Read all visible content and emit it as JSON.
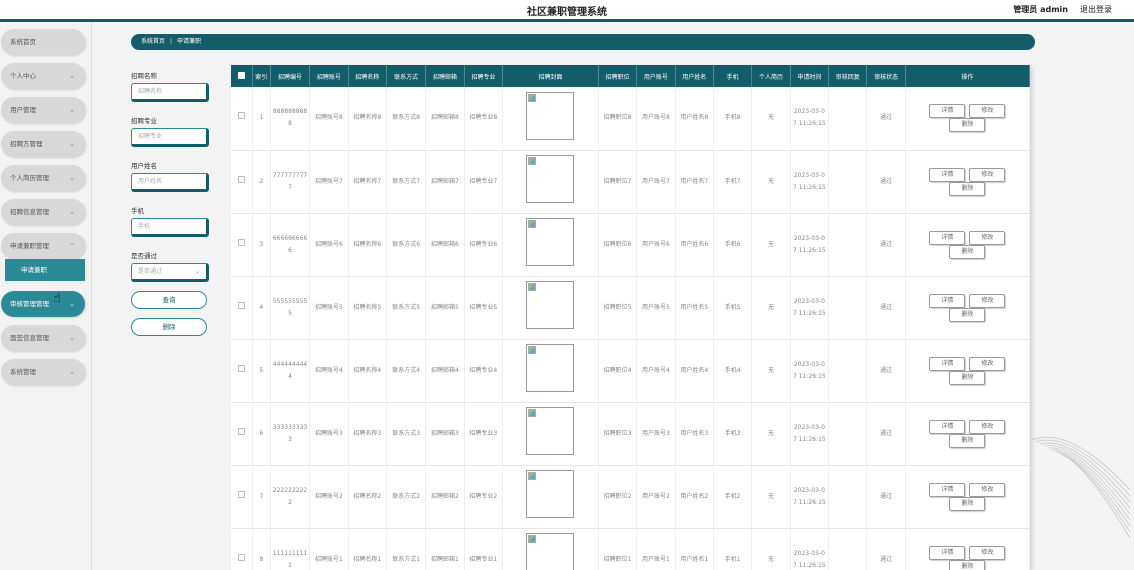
{
  "header": {
    "title": "社区兼职管理系统",
    "user": "管理员 admin",
    "logout": "退出登录"
  },
  "sidebar": {
    "items": [
      {
        "label": "系统首页",
        "chevron": false,
        "active": false
      },
      {
        "label": "个人中心",
        "chevron": true,
        "active": false
      },
      {
        "label": "用户管理",
        "chevron": true,
        "active": false
      },
      {
        "label": "招聘方管理",
        "chevron": true,
        "active": false
      },
      {
        "label": "个人简历管理",
        "chevron": true,
        "active": false
      },
      {
        "label": "招聘信息管理",
        "chevron": true,
        "active": false
      },
      {
        "label": "申请兼职管理",
        "chevron": true,
        "active": false
      },
      {
        "label": "审核管理管理",
        "chevron": true,
        "active": true
      },
      {
        "label": "面签信息管理",
        "chevron": true,
        "active": false
      },
      {
        "label": "系统管理",
        "chevron": true,
        "active": false
      }
    ],
    "sub_item": "申请兼职"
  },
  "breadcrumb": {
    "home": "系统首页",
    "current": "申请兼职"
  },
  "search": {
    "name_label": "招聘名称",
    "name_placeholder": "招聘名称",
    "major_label": "招聘专业",
    "major_placeholder": "招聘专业",
    "username_label": "用户姓名",
    "username_placeholder": "用户姓名",
    "phone_label": "手机",
    "phone_placeholder": "手机",
    "pass_label": "是否通过",
    "pass_placeholder": "是否通过",
    "query_button": "查询",
    "delete_button": "删除"
  },
  "table": {
    "headers": [
      "索引",
      "招聘编号",
      "招聘账号",
      "招聘名称",
      "联系方式",
      "招聘邮箱",
      "招聘专业",
      "招聘封面",
      "招聘职位",
      "用户账号",
      "用户姓名",
      "手机",
      "个人简历",
      "申请时间",
      "审核回复",
      "审核状态",
      "操作"
    ],
    "actions": {
      "detail": "详情",
      "edit": "修改",
      "delete": "删除"
    },
    "rows": [
      {
        "index": "1",
        "code": "8888888888",
        "account": "招聘账号8",
        "name": "招聘名称8",
        "contact": "联系方式8",
        "email": "招聘邮箱8",
        "major": "招聘专业8",
        "position": "招聘职位8",
        "user_account": "用户账号8",
        "user_name": "用户姓名8",
        "phone": "手机8",
        "resume": "无",
        "time": "2023-03-07 11:26:15",
        "reply": "",
        "status": "通过"
      },
      {
        "index": "2",
        "code": "7777777777",
        "account": "招聘账号7",
        "name": "招聘名称7",
        "contact": "联系方式7",
        "email": "招聘邮箱7",
        "major": "招聘专业7",
        "position": "招聘职位7",
        "user_account": "用户账号7",
        "user_name": "用户姓名7",
        "phone": "手机7",
        "resume": "无",
        "time": "2023-03-07 11:26:15",
        "reply": "",
        "status": "通过"
      },
      {
        "index": "3",
        "code": "6666666666",
        "account": "招聘账号6",
        "name": "招聘名称6",
        "contact": "联系方式6",
        "email": "招聘邮箱6",
        "major": "招聘专业6",
        "position": "招聘职位6",
        "user_account": "用户账号6",
        "user_name": "用户姓名6",
        "phone": "手机6",
        "resume": "无",
        "time": "2023-03-07 11:26:15",
        "reply": "",
        "status": "通过"
      },
      {
        "index": "4",
        "code": "5555555555",
        "account": "招聘账号5",
        "name": "招聘名称5",
        "contact": "联系方式5",
        "email": "招聘邮箱5",
        "major": "招聘专业5",
        "position": "招聘职位5",
        "user_account": "用户账号5",
        "user_name": "用户姓名5",
        "phone": "手机5",
        "resume": "无",
        "time": "2023-03-07 11:26:15",
        "reply": "",
        "status": "通过"
      },
      {
        "index": "5",
        "code": "4444444444",
        "account": "招聘账号4",
        "name": "招聘名称4",
        "contact": "联系方式4",
        "email": "招聘邮箱4",
        "major": "招聘专业4",
        "position": "招聘职位4",
        "user_account": "用户账号4",
        "user_name": "用户姓名4",
        "phone": "手机4",
        "resume": "无",
        "time": "2023-03-07 11:26:15",
        "reply": "",
        "status": "通过"
      },
      {
        "index": "6",
        "code": "3333333333",
        "account": "招聘账号3",
        "name": "招聘名称3",
        "contact": "联系方式3",
        "email": "招聘邮箱3",
        "major": "招聘专业3",
        "position": "招聘职位3",
        "user_account": "用户账号3",
        "user_name": "用户姓名3",
        "phone": "手机3",
        "resume": "无",
        "time": "2023-03-07 11:26:15",
        "reply": "",
        "status": "通过"
      },
      {
        "index": "7",
        "code": "2222222222",
        "account": "招聘账号2",
        "name": "招聘名称2",
        "contact": "联系方式2",
        "email": "招聘邮箱2",
        "major": "招聘专业2",
        "position": "招聘职位2",
        "user_account": "用户账号2",
        "user_name": "用户姓名2",
        "phone": "手机2",
        "resume": "无",
        "time": "2023-03-07 11:26:15",
        "reply": "",
        "status": "通过"
      },
      {
        "index": "8",
        "code": "1111111111",
        "account": "招聘账号1",
        "name": "招聘名称1",
        "contact": "联系方式1",
        "email": "招聘邮箱1",
        "major": "招聘专业1",
        "position": "招聘职位1",
        "user_account": "用户账号1",
        "user_name": "用户姓名1",
        "phone": "手机1",
        "resume": "无",
        "time": "2023-03-07 11:26:15",
        "reply": "",
        "status": "通过"
      }
    ]
  },
  "colors": {
    "primary": "#135d6a",
    "accent": "#2a8a96",
    "sidebar_item": "#d8d8d8"
  },
  "icons": {
    "cursor": "hand-pointer-icon",
    "chevron": "chevron-down-icon",
    "broken_image": "broken-image-icon"
  }
}
